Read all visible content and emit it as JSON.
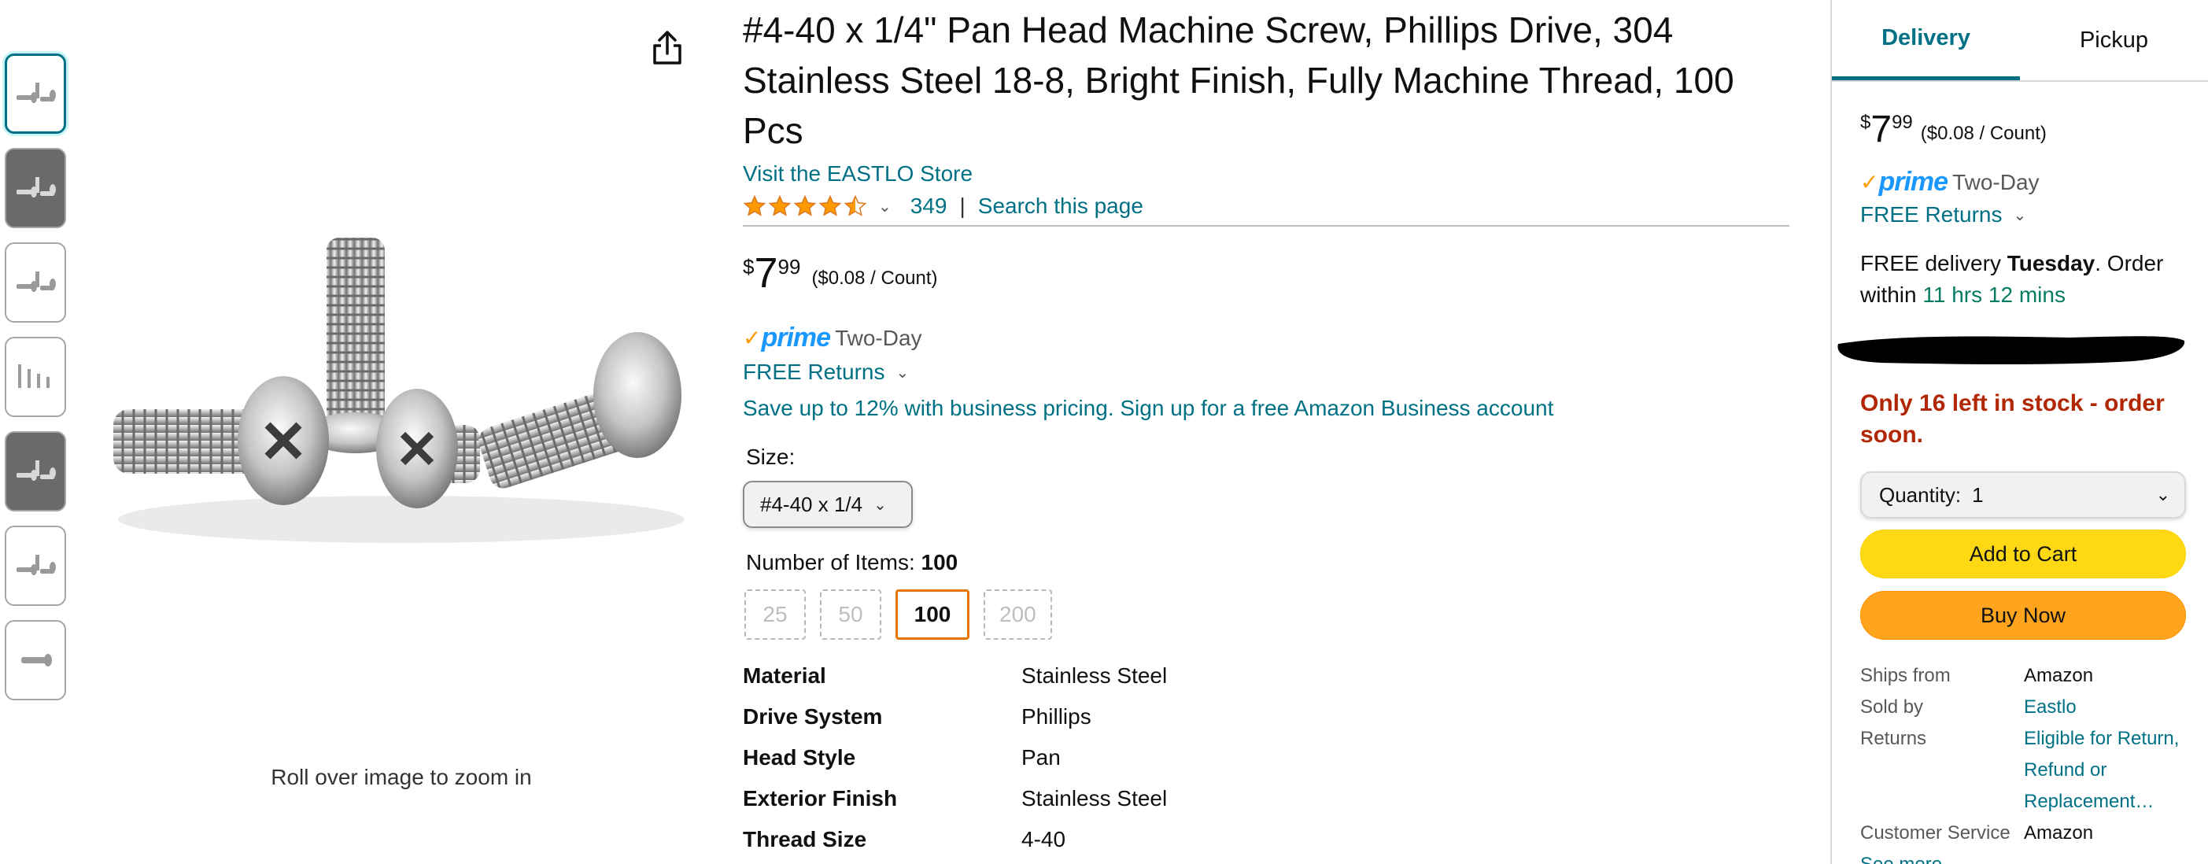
{
  "thumbnails": [
    {
      "name": "thumb-screws-1",
      "active": true,
      "dark": false
    },
    {
      "name": "thumb-screws-wood",
      "active": false,
      "dark": true
    },
    {
      "name": "thumb-screws-2",
      "active": false,
      "dark": false
    },
    {
      "name": "thumb-screws-dimensions",
      "active": false,
      "dark": false
    },
    {
      "name": "thumb-screws-wood-2",
      "active": false,
      "dark": true
    },
    {
      "name": "thumb-screws-3",
      "active": false,
      "dark": false
    },
    {
      "name": "thumb-screw-single",
      "active": false,
      "dark": false
    }
  ],
  "image": {
    "zoom_hint": "Roll over image to zoom in"
  },
  "product": {
    "title": "#4-40 x 1/4\" Pan Head Machine Screw, Phillips Drive, 304 Stainless Steel 18-8, Bright Finish, Fully Machine Thread, 100 Pcs",
    "store_link": "Visit the EASTLO Store",
    "rating_stars": 4.5,
    "rating_count": "349",
    "rating_separator": "|",
    "search_page": "Search this page",
    "price": {
      "symbol": "$",
      "whole": "7",
      "fraction": "99",
      "unit": "($0.08 / Count)"
    },
    "prime_check": "✓",
    "prime_word": "prime",
    "prime_two_day": "Two-Day",
    "free_returns": "FREE Returns",
    "business": "Save up to 12% with business pricing. Sign up for a free Amazon Business account",
    "size_label": "Size:",
    "size_value": "#4-40 x 1/4",
    "items_label": "Number of Items:",
    "items_value": "100",
    "item_options": [
      {
        "label": "25",
        "selected": false
      },
      {
        "label": "50",
        "selected": false
      },
      {
        "label": "100",
        "selected": true
      },
      {
        "label": "200",
        "selected": false
      }
    ],
    "specs": [
      {
        "key": "Material",
        "value": "Stainless Steel"
      },
      {
        "key": "Drive System",
        "value": "Phillips"
      },
      {
        "key": "Head Style",
        "value": "Pan"
      },
      {
        "key": "Exterior Finish",
        "value": "Stainless Steel"
      },
      {
        "key": "Thread Size",
        "value": "4-40"
      }
    ]
  },
  "buybox": {
    "tabs": [
      {
        "label": "Delivery",
        "active": true
      },
      {
        "label": "Pickup",
        "active": false
      }
    ],
    "price": {
      "symbol": "$",
      "whole": "7",
      "fraction": "99",
      "unit": "($0.08 / Count)"
    },
    "prime_check": "✓",
    "prime_word": "prime",
    "prime_two_day": "Two-Day",
    "free_returns": "FREE Returns",
    "delivery_prefix": "FREE delivery ",
    "delivery_day": "Tuesday",
    "delivery_mid": ". Order within ",
    "delivery_countdown": "11 hrs 12 mins",
    "stock": "Only 16 left in stock - order soon.",
    "qty_label": "Quantity:",
    "qty_value": "1",
    "add_to_cart": "Add to Cart",
    "buy_now": "Buy Now",
    "ship_rows": [
      {
        "key": "Ships from",
        "value": "Amazon",
        "link": false
      },
      {
        "key": "Sold by",
        "value": "Eastlo",
        "link": true
      },
      {
        "key": "Returns",
        "value": "Eligible for Return, Refund or Replacement…",
        "link": true
      },
      {
        "key": "Customer Service",
        "value": "Amazon",
        "link": false
      }
    ],
    "see_more": "See more"
  },
  "colors": {
    "link": "#007185",
    "price_red": "#b12704",
    "countdown_green": "#067d62",
    "cart_yellow": "#ffd814",
    "buy_orange": "#ffa41c",
    "prime_blue": "#1a98ff",
    "prime_orange": "#ff9900",
    "swatch_selected": "#e77600"
  },
  "icons": {
    "share": "share-icon",
    "star": "star-icon",
    "chevron": "chevron-down-icon"
  }
}
